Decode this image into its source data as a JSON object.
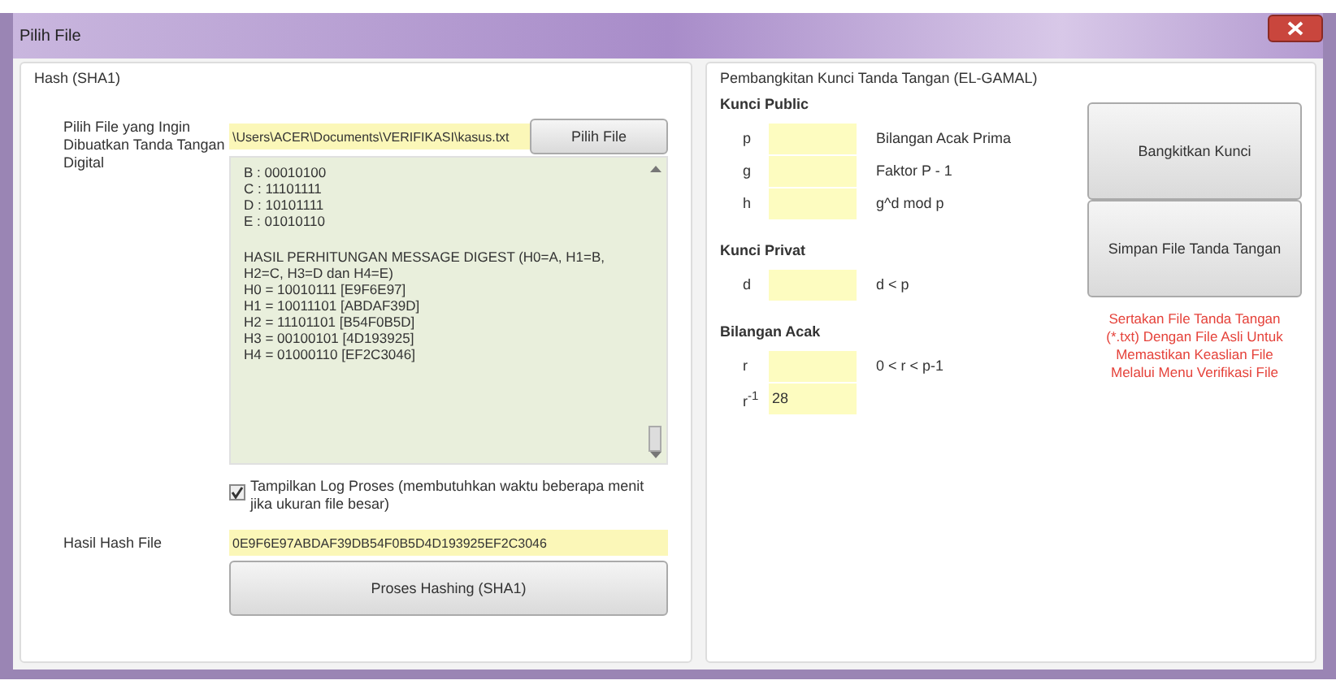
{
  "window": {
    "title": "Pilih File"
  },
  "hash_group": {
    "title": "Hash (SHA1)",
    "file_label": "Pilih File yang Ingin Dibuatkan Tanda Tangan Digital",
    "file_path": "\\Users\\ACER\\Documents\\VERIFIKASI\\kasus.txt",
    "browse_button": "Pilih File",
    "log": [
      {
        "kind": "line",
        "text": "B : 00010100"
      },
      {
        "kind": "line",
        "text": "C : 11101111"
      },
      {
        "kind": "line",
        "text": "D : 10101111"
      },
      {
        "kind": "line",
        "text": "E : 01010110"
      },
      {
        "kind": "heading",
        "text": "HASIL PERHITUNGAN MESSAGE DIGEST (H0=A, H1=B, H2=C, H3=D dan H4=E)"
      },
      {
        "kind": "line",
        "text": "H0 = 10010111 [E9F6E97]"
      },
      {
        "kind": "line",
        "text": "H1 = 10011101 [ABDAF39D]"
      },
      {
        "kind": "line",
        "text": "H2 = 11101101 [B54F0B5D]"
      },
      {
        "kind": "line",
        "text": "H3 = 00100101 [4D193925]"
      },
      {
        "kind": "line",
        "text": "H4 = 01000110 [EF2C3046]"
      }
    ],
    "show_log": {
      "label": "Tampilkan Log Proses (membutuhkan waktu beberapa menit jika ukuran file besar)",
      "checked": true
    },
    "result_label": "Hasil Hash File",
    "result_value": "0E9F6E97ABDAF39DB54F0B5D4D193925EF2C3046",
    "process_button": "Proses Hashing (SHA1)"
  },
  "key_group": {
    "title": "Pembangkitan Kunci Tanda Tangan (EL-GAMAL)",
    "sections": [
      {
        "title": "Kunci Public",
        "rows": [
          {
            "label": "p",
            "note": "Bilangan Acak Prima"
          },
          {
            "label": "g",
            "note": "Faktor P - 1"
          },
          {
            "label": "h",
            "note": "g^d mod p"
          }
        ]
      },
      {
        "title": "Kunci Privat",
        "rows": [
          {
            "label": "d",
            "note": "d < p"
          }
        ]
      },
      {
        "title": "Bilangan Acak",
        "rows": [
          {
            "label": "r",
            "note": "0 < r < p-1"
          },
          {
            "label": "r$^{-1}$",
            "value": "28"
          }
        ]
      }
    ],
    "buttons": [
      "Bangkitkan Kunci",
      "Simpan File Tanda Tangan"
    ],
    "hint": "Sertakan File Tanda Tangan (*.txt) Dengan File Asli Untuk Memastikan Keaslian File Melalui Menu Verifikasi File"
  }
}
